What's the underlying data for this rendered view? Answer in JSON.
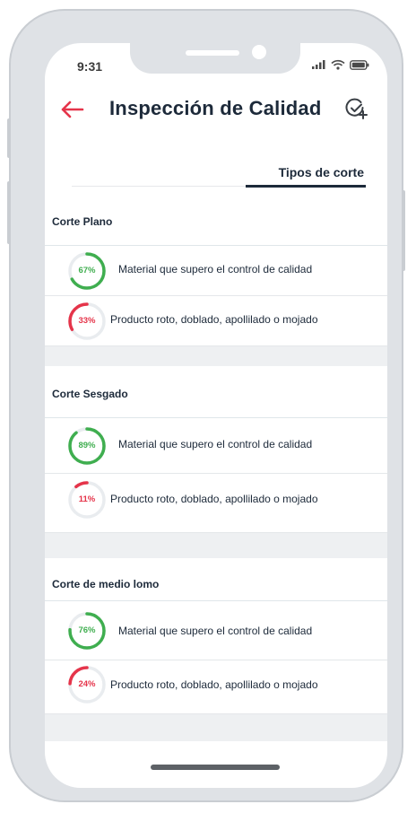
{
  "status": {
    "time": "9:31",
    "icons": [
      "signal-icon",
      "wifi-icon",
      "battery-icon"
    ]
  },
  "header": {
    "title": "Inspección de Calidad",
    "back_icon": "arrow-left-icon",
    "action_icon": "check-plus-icon"
  },
  "tabs": [
    {
      "label": "Tipos de corte",
      "active": true
    }
  ],
  "colors": {
    "accent_red": "#e5344a",
    "good_green": "#3fae4f",
    "text_dark": "#1d2a3a",
    "ring_track": "#e9ecef"
  },
  "sections": [
    {
      "title": "Corte Plano",
      "rows": [
        {
          "percent": 67,
          "label": "67%",
          "text": "Material que supero el control de calidad",
          "type": "good"
        },
        {
          "percent": 33,
          "label": "33%",
          "text": "Producto roto, doblado, apollilado o mojado",
          "type": "bad"
        }
      ]
    },
    {
      "title": "Corte Sesgado",
      "rows": [
        {
          "percent": 89,
          "label": "89%",
          "text": "Material que supero el control de calidad",
          "type": "good"
        },
        {
          "percent": 11,
          "label": "11%",
          "text": "Producto roto, doblado, apollilado o mojado",
          "type": "bad"
        }
      ]
    },
    {
      "title": "Corte de medio lomo",
      "rows": [
        {
          "percent": 76,
          "label": "76%",
          "text": "Material que supero el control de calidad",
          "type": "good"
        },
        {
          "percent": 24,
          "label": "24%",
          "text": "Producto roto, doblado, apollilado o mojado",
          "type": "bad"
        }
      ]
    }
  ]
}
